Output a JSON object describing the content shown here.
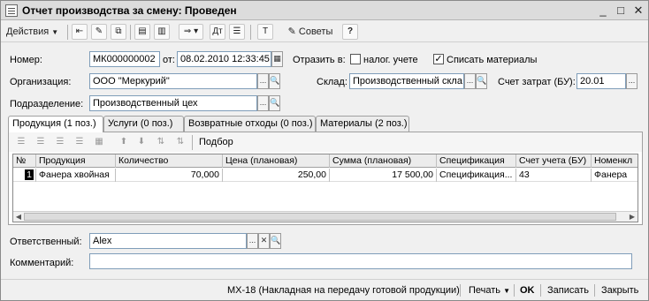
{
  "window": {
    "title": "Отчет производства за смену: Проведен",
    "controls": {
      "minimize": "_",
      "maximize": "□",
      "close": "✕"
    }
  },
  "toolbar": {
    "actions_label": "Действия",
    "tips_label": "Советы",
    "help_label": "?"
  },
  "header": {
    "number_label": "Номер:",
    "number_value": "МК000000002",
    "from_label": "от:",
    "date_value": "08.02.2010 12:33:45",
    "reflect_label": "Отразить в:",
    "tax_label": "налог. учете",
    "tax_checked": false,
    "writeoff_label": "Списать материалы",
    "writeoff_checked": true,
    "org_label": "Организация:",
    "org_value": "ООО \"Меркурий\"",
    "warehouse_label": "Склад:",
    "warehouse_value": "Производственный скла",
    "account_label": "Счет затрат (БУ):",
    "account_value": "20.01",
    "dept_label": "Подразделение:",
    "dept_value": "Производственный цех"
  },
  "tabs": [
    {
      "label": "Продукция (1 поз.)",
      "active": true
    },
    {
      "label": "Услуги (0 поз.)",
      "active": false
    },
    {
      "label": "Возвратные отходы (0 поз.)",
      "active": false
    },
    {
      "label": "Материалы (2 поз.)",
      "active": false
    }
  ],
  "subtoolbar": {
    "selection_label": "Подбор"
  },
  "table": {
    "columns": [
      "№",
      "Продукция",
      "Количество",
      "Цена (плановая)",
      "Сумма (плановая)",
      "Спецификация",
      "Счет учета (БУ)",
      "Номенкл"
    ],
    "rows": [
      [
        "1",
        "Фанера хвойная",
        "70,000",
        "250,00",
        "17 500,00",
        "Спецификация...",
        "43",
        "Фанера"
      ]
    ]
  },
  "footer": {
    "responsible_label": "Ответственный:",
    "responsible_value": "Alex",
    "comment_label": "Комментарий:",
    "comment_value": ""
  },
  "statusbar": {
    "mx18_label": "МХ-18 (Накладная на передачу готовой продукции)",
    "print_label": "Печать",
    "ok_label": "OK",
    "save_label": "Записать",
    "close_label": "Закрыть"
  }
}
